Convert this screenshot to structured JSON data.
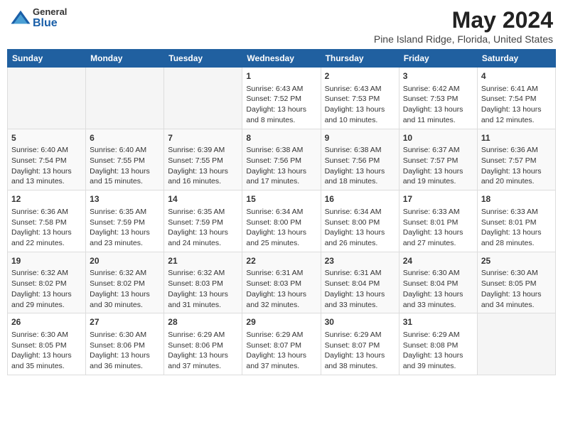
{
  "logo": {
    "general": "General",
    "blue": "Blue"
  },
  "title": "May 2024",
  "location": "Pine Island Ridge, Florida, United States",
  "days_of_week": [
    "Sunday",
    "Monday",
    "Tuesday",
    "Wednesday",
    "Thursday",
    "Friday",
    "Saturday"
  ],
  "weeks": [
    [
      {
        "day": "",
        "empty": true,
        "lines": []
      },
      {
        "day": "",
        "empty": true,
        "lines": []
      },
      {
        "day": "",
        "empty": true,
        "lines": []
      },
      {
        "day": "1",
        "empty": false,
        "lines": [
          "Sunrise: 6:43 AM",
          "Sunset: 7:52 PM",
          "Daylight: 13 hours",
          "and 8 minutes."
        ]
      },
      {
        "day": "2",
        "empty": false,
        "lines": [
          "Sunrise: 6:43 AM",
          "Sunset: 7:53 PM",
          "Daylight: 13 hours",
          "and 10 minutes."
        ]
      },
      {
        "day": "3",
        "empty": false,
        "lines": [
          "Sunrise: 6:42 AM",
          "Sunset: 7:53 PM",
          "Daylight: 13 hours",
          "and 11 minutes."
        ]
      },
      {
        "day": "4",
        "empty": false,
        "lines": [
          "Sunrise: 6:41 AM",
          "Sunset: 7:54 PM",
          "Daylight: 13 hours",
          "and 12 minutes."
        ]
      }
    ],
    [
      {
        "day": "5",
        "empty": false,
        "lines": [
          "Sunrise: 6:40 AM",
          "Sunset: 7:54 PM",
          "Daylight: 13 hours",
          "and 13 minutes."
        ]
      },
      {
        "day": "6",
        "empty": false,
        "lines": [
          "Sunrise: 6:40 AM",
          "Sunset: 7:55 PM",
          "Daylight: 13 hours",
          "and 15 minutes."
        ]
      },
      {
        "day": "7",
        "empty": false,
        "lines": [
          "Sunrise: 6:39 AM",
          "Sunset: 7:55 PM",
          "Daylight: 13 hours",
          "and 16 minutes."
        ]
      },
      {
        "day": "8",
        "empty": false,
        "lines": [
          "Sunrise: 6:38 AM",
          "Sunset: 7:56 PM",
          "Daylight: 13 hours",
          "and 17 minutes."
        ]
      },
      {
        "day": "9",
        "empty": false,
        "lines": [
          "Sunrise: 6:38 AM",
          "Sunset: 7:56 PM",
          "Daylight: 13 hours",
          "and 18 minutes."
        ]
      },
      {
        "day": "10",
        "empty": false,
        "lines": [
          "Sunrise: 6:37 AM",
          "Sunset: 7:57 PM",
          "Daylight: 13 hours",
          "and 19 minutes."
        ]
      },
      {
        "day": "11",
        "empty": false,
        "lines": [
          "Sunrise: 6:36 AM",
          "Sunset: 7:57 PM",
          "Daylight: 13 hours",
          "and 20 minutes."
        ]
      }
    ],
    [
      {
        "day": "12",
        "empty": false,
        "lines": [
          "Sunrise: 6:36 AM",
          "Sunset: 7:58 PM",
          "Daylight: 13 hours",
          "and 22 minutes."
        ]
      },
      {
        "day": "13",
        "empty": false,
        "lines": [
          "Sunrise: 6:35 AM",
          "Sunset: 7:59 PM",
          "Daylight: 13 hours",
          "and 23 minutes."
        ]
      },
      {
        "day": "14",
        "empty": false,
        "lines": [
          "Sunrise: 6:35 AM",
          "Sunset: 7:59 PM",
          "Daylight: 13 hours",
          "and 24 minutes."
        ]
      },
      {
        "day": "15",
        "empty": false,
        "lines": [
          "Sunrise: 6:34 AM",
          "Sunset: 8:00 PM",
          "Daylight: 13 hours",
          "and 25 minutes."
        ]
      },
      {
        "day": "16",
        "empty": false,
        "lines": [
          "Sunrise: 6:34 AM",
          "Sunset: 8:00 PM",
          "Daylight: 13 hours",
          "and 26 minutes."
        ]
      },
      {
        "day": "17",
        "empty": false,
        "lines": [
          "Sunrise: 6:33 AM",
          "Sunset: 8:01 PM",
          "Daylight: 13 hours",
          "and 27 minutes."
        ]
      },
      {
        "day": "18",
        "empty": false,
        "lines": [
          "Sunrise: 6:33 AM",
          "Sunset: 8:01 PM",
          "Daylight: 13 hours",
          "and 28 minutes."
        ]
      }
    ],
    [
      {
        "day": "19",
        "empty": false,
        "lines": [
          "Sunrise: 6:32 AM",
          "Sunset: 8:02 PM",
          "Daylight: 13 hours",
          "and 29 minutes."
        ]
      },
      {
        "day": "20",
        "empty": false,
        "lines": [
          "Sunrise: 6:32 AM",
          "Sunset: 8:02 PM",
          "Daylight: 13 hours",
          "and 30 minutes."
        ]
      },
      {
        "day": "21",
        "empty": false,
        "lines": [
          "Sunrise: 6:32 AM",
          "Sunset: 8:03 PM",
          "Daylight: 13 hours",
          "and 31 minutes."
        ]
      },
      {
        "day": "22",
        "empty": false,
        "lines": [
          "Sunrise: 6:31 AM",
          "Sunset: 8:03 PM",
          "Daylight: 13 hours",
          "and 32 minutes."
        ]
      },
      {
        "day": "23",
        "empty": false,
        "lines": [
          "Sunrise: 6:31 AM",
          "Sunset: 8:04 PM",
          "Daylight: 13 hours",
          "and 33 minutes."
        ]
      },
      {
        "day": "24",
        "empty": false,
        "lines": [
          "Sunrise: 6:30 AM",
          "Sunset: 8:04 PM",
          "Daylight: 13 hours",
          "and 33 minutes."
        ]
      },
      {
        "day": "25",
        "empty": false,
        "lines": [
          "Sunrise: 6:30 AM",
          "Sunset: 8:05 PM",
          "Daylight: 13 hours",
          "and 34 minutes."
        ]
      }
    ],
    [
      {
        "day": "26",
        "empty": false,
        "lines": [
          "Sunrise: 6:30 AM",
          "Sunset: 8:05 PM",
          "Daylight: 13 hours",
          "and 35 minutes."
        ]
      },
      {
        "day": "27",
        "empty": false,
        "lines": [
          "Sunrise: 6:30 AM",
          "Sunset: 8:06 PM",
          "Daylight: 13 hours",
          "and 36 minutes."
        ]
      },
      {
        "day": "28",
        "empty": false,
        "lines": [
          "Sunrise: 6:29 AM",
          "Sunset: 8:06 PM",
          "Daylight: 13 hours",
          "and 37 minutes."
        ]
      },
      {
        "day": "29",
        "empty": false,
        "lines": [
          "Sunrise: 6:29 AM",
          "Sunset: 8:07 PM",
          "Daylight: 13 hours",
          "and 37 minutes."
        ]
      },
      {
        "day": "30",
        "empty": false,
        "lines": [
          "Sunrise: 6:29 AM",
          "Sunset: 8:07 PM",
          "Daylight: 13 hours",
          "and 38 minutes."
        ]
      },
      {
        "day": "31",
        "empty": false,
        "lines": [
          "Sunrise: 6:29 AM",
          "Sunset: 8:08 PM",
          "Daylight: 13 hours",
          "and 39 minutes."
        ]
      },
      {
        "day": "",
        "empty": true,
        "lines": []
      }
    ]
  ]
}
